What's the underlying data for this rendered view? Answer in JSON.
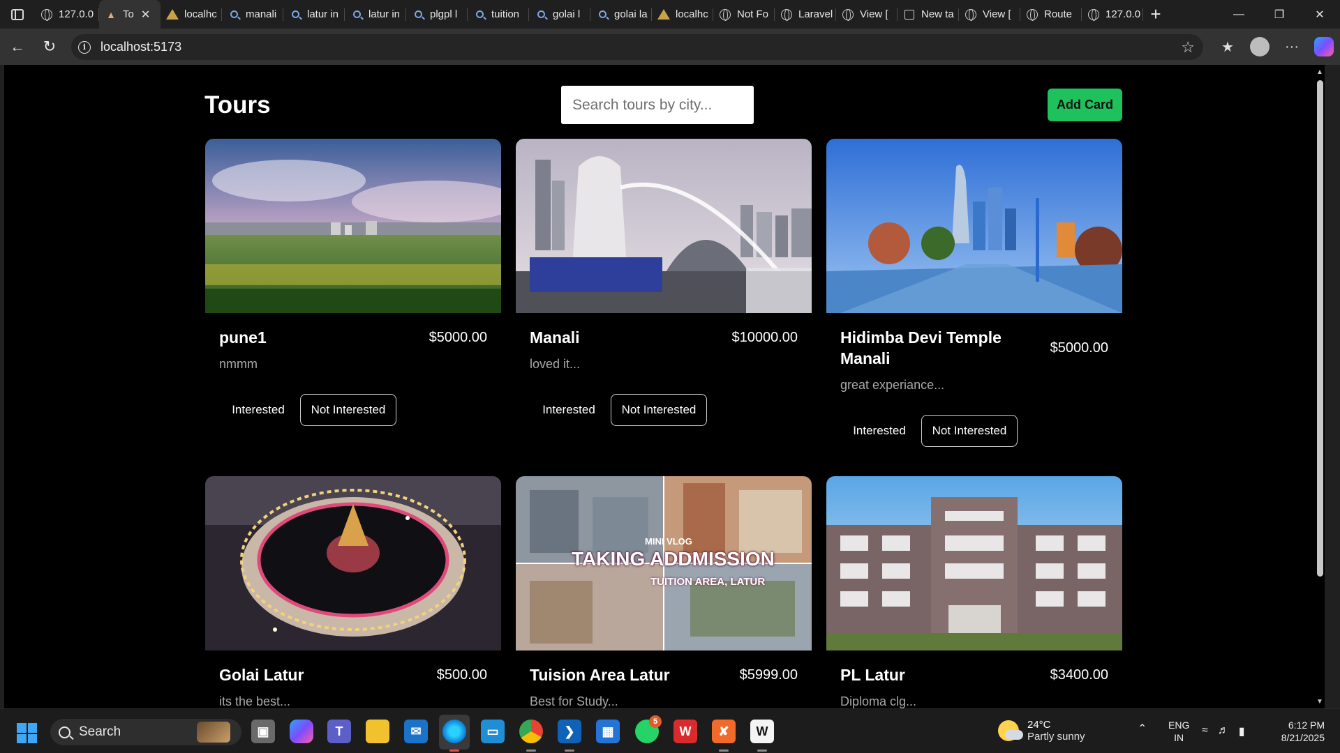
{
  "browser": {
    "tabs": [
      {
        "label": "127.0.0",
        "icon": "globe-icon"
      },
      {
        "label": "To",
        "icon": "tour-favicon-icon",
        "active": true
      },
      {
        "label": "localhc",
        "icon": "vite-icon"
      },
      {
        "label": "manali",
        "icon": "search-icon"
      },
      {
        "label": "latur in",
        "icon": "search-icon"
      },
      {
        "label": "latur in",
        "icon": "search-icon"
      },
      {
        "label": "plgpl l",
        "icon": "search-icon"
      },
      {
        "label": "tuition",
        "icon": "search-icon"
      },
      {
        "label": "golai l",
        "icon": "search-icon"
      },
      {
        "label": "golai la",
        "icon": "search-icon"
      },
      {
        "label": "localhc",
        "icon": "vite-icon"
      },
      {
        "label": "Not Fo",
        "icon": "globe-icon"
      },
      {
        "label": "Laravel",
        "icon": "globe-icon"
      },
      {
        "label": "View [",
        "icon": "globe-icon"
      },
      {
        "label": "New ta",
        "icon": "page-icon"
      },
      {
        "label": "View [",
        "icon": "globe-icon"
      },
      {
        "label": "Route",
        "icon": "globe-icon"
      },
      {
        "label": "127.0.0",
        "icon": "globe-icon"
      }
    ],
    "address": "localhost:5173"
  },
  "page": {
    "title": "Tours",
    "search_placeholder": "Search tours by city...",
    "add_card_label": "Add Card",
    "interested_label": "Interested",
    "not_interested_label": "Not Interested",
    "cards": [
      {
        "title": "pune1",
        "price": "$5000.00",
        "description": "nmmm"
      },
      {
        "title": "Manali",
        "price": "$10000.00",
        "description": "loved it..."
      },
      {
        "title": "Hidimba Devi Temple Manali",
        "price": "$5000.00",
        "description": "great experiance..."
      },
      {
        "title": "Golai Latur",
        "price": "$500.00",
        "description": "its the best..."
      },
      {
        "title": "Tuision Area Latur",
        "price": "$5999.00",
        "description": "Best for Study..."
      },
      {
        "title": "PL Latur",
        "price": "$3400.00",
        "description": "Diploma clg..."
      }
    ],
    "thumbnail_text": {
      "line1": "MINI VLOG",
      "line2": "TAKING ADDMISSION",
      "line3": "TUITION AREA, LATUR"
    }
  },
  "taskbar": {
    "search_label": "Search",
    "whatsapp_badge": "5",
    "weather_temp": "24°C",
    "weather_desc": "Partly sunny",
    "lang_line1": "ENG",
    "lang_line2": "IN",
    "time": "6:12 PM",
    "date": "8/21/2025"
  },
  "colors": {
    "accent_green": "#1ec15c",
    "page_bg": "#000000"
  }
}
